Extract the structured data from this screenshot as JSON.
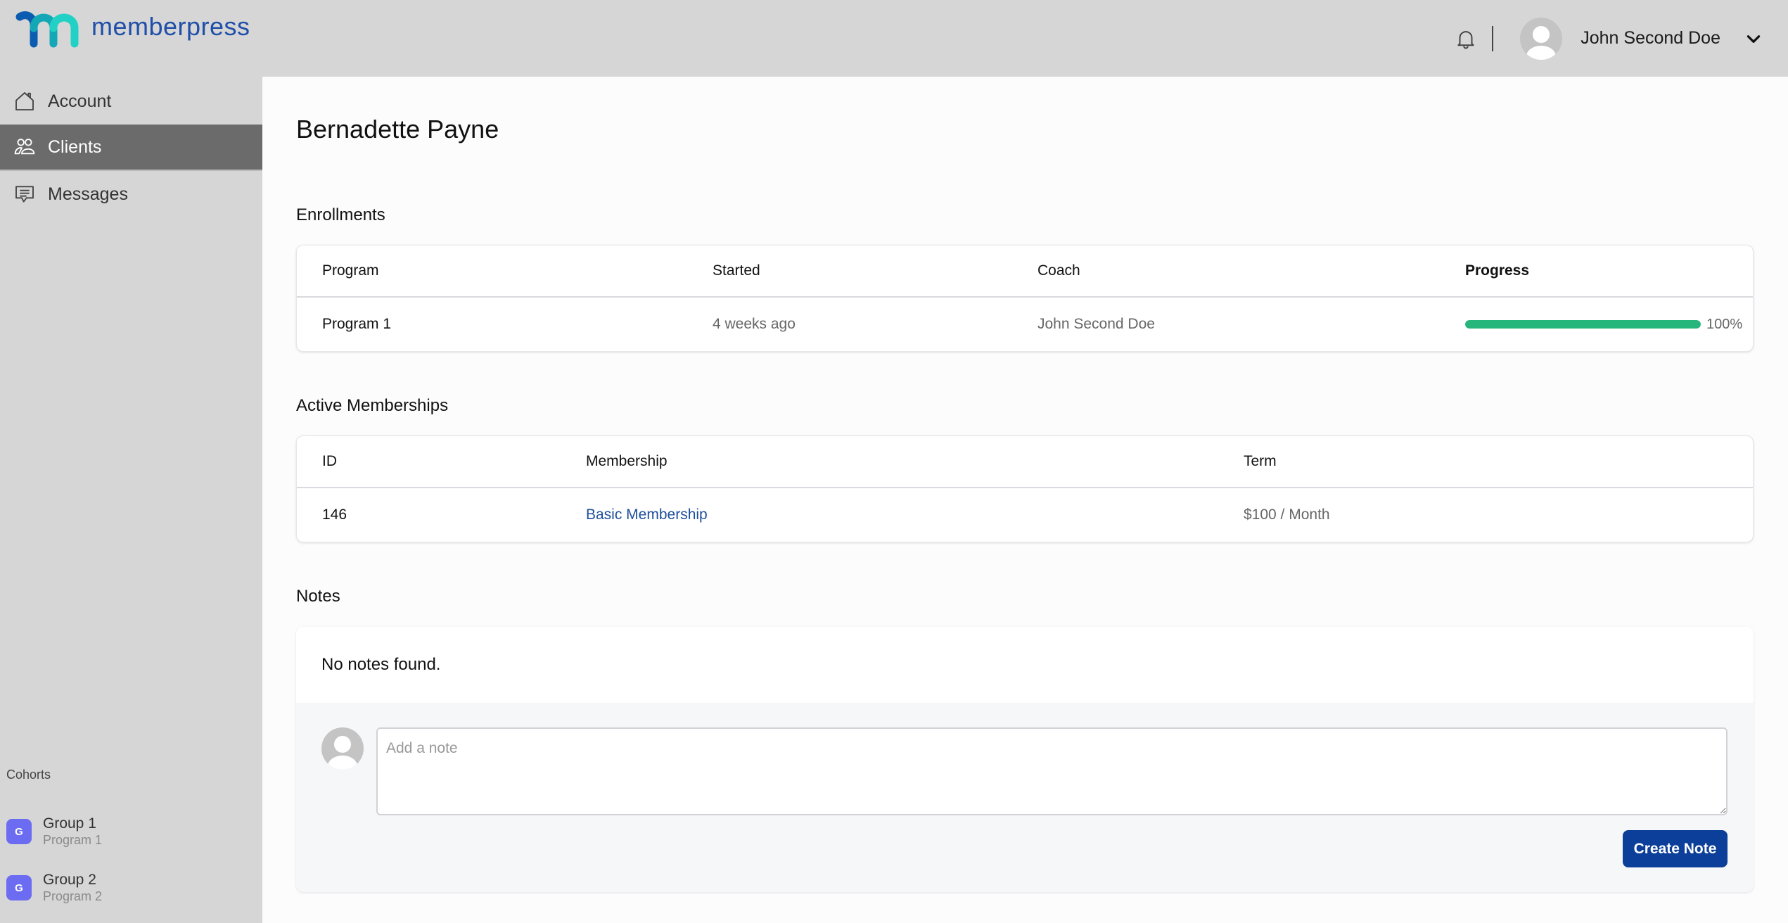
{
  "app": {
    "brand": "memberpress",
    "colors": {
      "brand_blue": "#1f4fa8",
      "accent_teal": "#1fc7c7",
      "primary_button": "#0b3f99",
      "progress_green": "#26b57a",
      "cohort_badge": "#6c6cf2",
      "link": "#1e4f9c"
    }
  },
  "header": {
    "notification_icon": "bell-icon",
    "user": {
      "name": "John Second Doe",
      "avatar_icon": "user-avatar-icon",
      "menu_icon": "chevron-down-icon"
    }
  },
  "sidebar": {
    "items": [
      {
        "label": "Account",
        "icon": "home-icon",
        "active": false
      },
      {
        "label": "Clients",
        "icon": "users-icon",
        "active": true
      },
      {
        "label": "Messages",
        "icon": "message-icon",
        "active": false
      }
    ],
    "cohorts": {
      "label": "Cohorts",
      "items": [
        {
          "badge": "G",
          "name": "Group 1",
          "program": "Program 1"
        },
        {
          "badge": "G",
          "name": "Group 2",
          "program": "Program 2"
        }
      ]
    }
  },
  "main": {
    "title": "Bernadette Payne",
    "enrollments": {
      "heading": "Enrollments",
      "columns": [
        "Program",
        "Started",
        "Coach",
        "Progress"
      ],
      "rows": [
        {
          "program": "Program 1",
          "started": "4 weeks ago",
          "coach": "John Second Doe",
          "progress_percent": 100,
          "progress_label": "100%"
        }
      ]
    },
    "memberships": {
      "heading": "Active Memberships",
      "columns": [
        "ID",
        "Membership",
        "Term"
      ],
      "rows": [
        {
          "id": "146",
          "membership": "Basic Membership",
          "term": "$100 / Month"
        }
      ]
    },
    "notes": {
      "heading": "Notes",
      "empty_text": "No notes found.",
      "input_placeholder": "Add a note",
      "input_value": "",
      "create_button": "Create Note"
    }
  }
}
